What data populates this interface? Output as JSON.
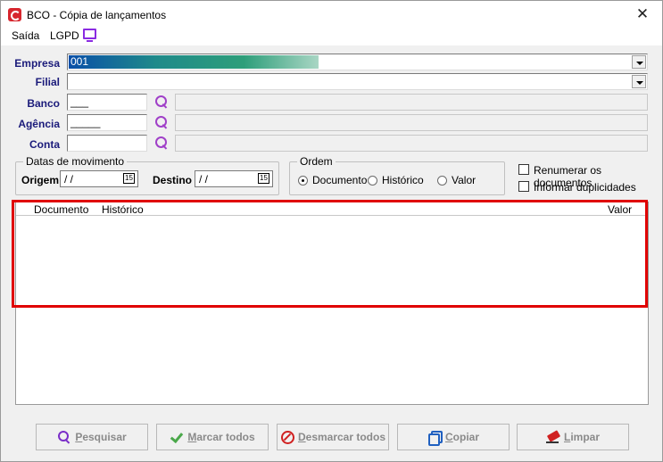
{
  "window": {
    "title": "BCO - Cópia de lançamentos",
    "close_glyph": "✕"
  },
  "menu": {
    "saida": "Saída",
    "lgpd": "LGPD"
  },
  "form": {
    "empresa_label": "Empresa",
    "empresa_value": "001",
    "filial_label": "Filial",
    "banco_label": "Banco",
    "banco_value": "___",
    "agencia_label": "Agência",
    "agencia_value": "_____",
    "conta_label": "Conta"
  },
  "datas": {
    "group_title": "Datas de movimento",
    "origem_label": "Origem",
    "origem_value": " / /",
    "destino_label": "Destino",
    "destino_value": " / /",
    "cal_glyph": "15"
  },
  "ordem": {
    "group_title": "Ordem",
    "options": [
      "Documento",
      "Histórico",
      "Valor"
    ],
    "selected": "Documento"
  },
  "options": {
    "renumerar": "Renumerar os documentos",
    "duplicidades": "Informar duplicidades"
  },
  "grid": {
    "columns": [
      "Documento",
      "Histórico",
      "Valor"
    ]
  },
  "buttons": {
    "pesquisar": {
      "ul": "P",
      "rest": "esquisar"
    },
    "marcar": {
      "ul": "M",
      "rest": "arcar todos"
    },
    "desmarcar": {
      "ul": "D",
      "rest": "esmarcar todos"
    },
    "copiar": {
      "ul": "C",
      "rest": "opiar"
    },
    "limpar": {
      "ul": "L",
      "rest": "impar"
    }
  },
  "colors": {
    "accent": "#1a1a7a",
    "highlight": "#e00000",
    "lgpd_icon": "#8a2be2"
  }
}
